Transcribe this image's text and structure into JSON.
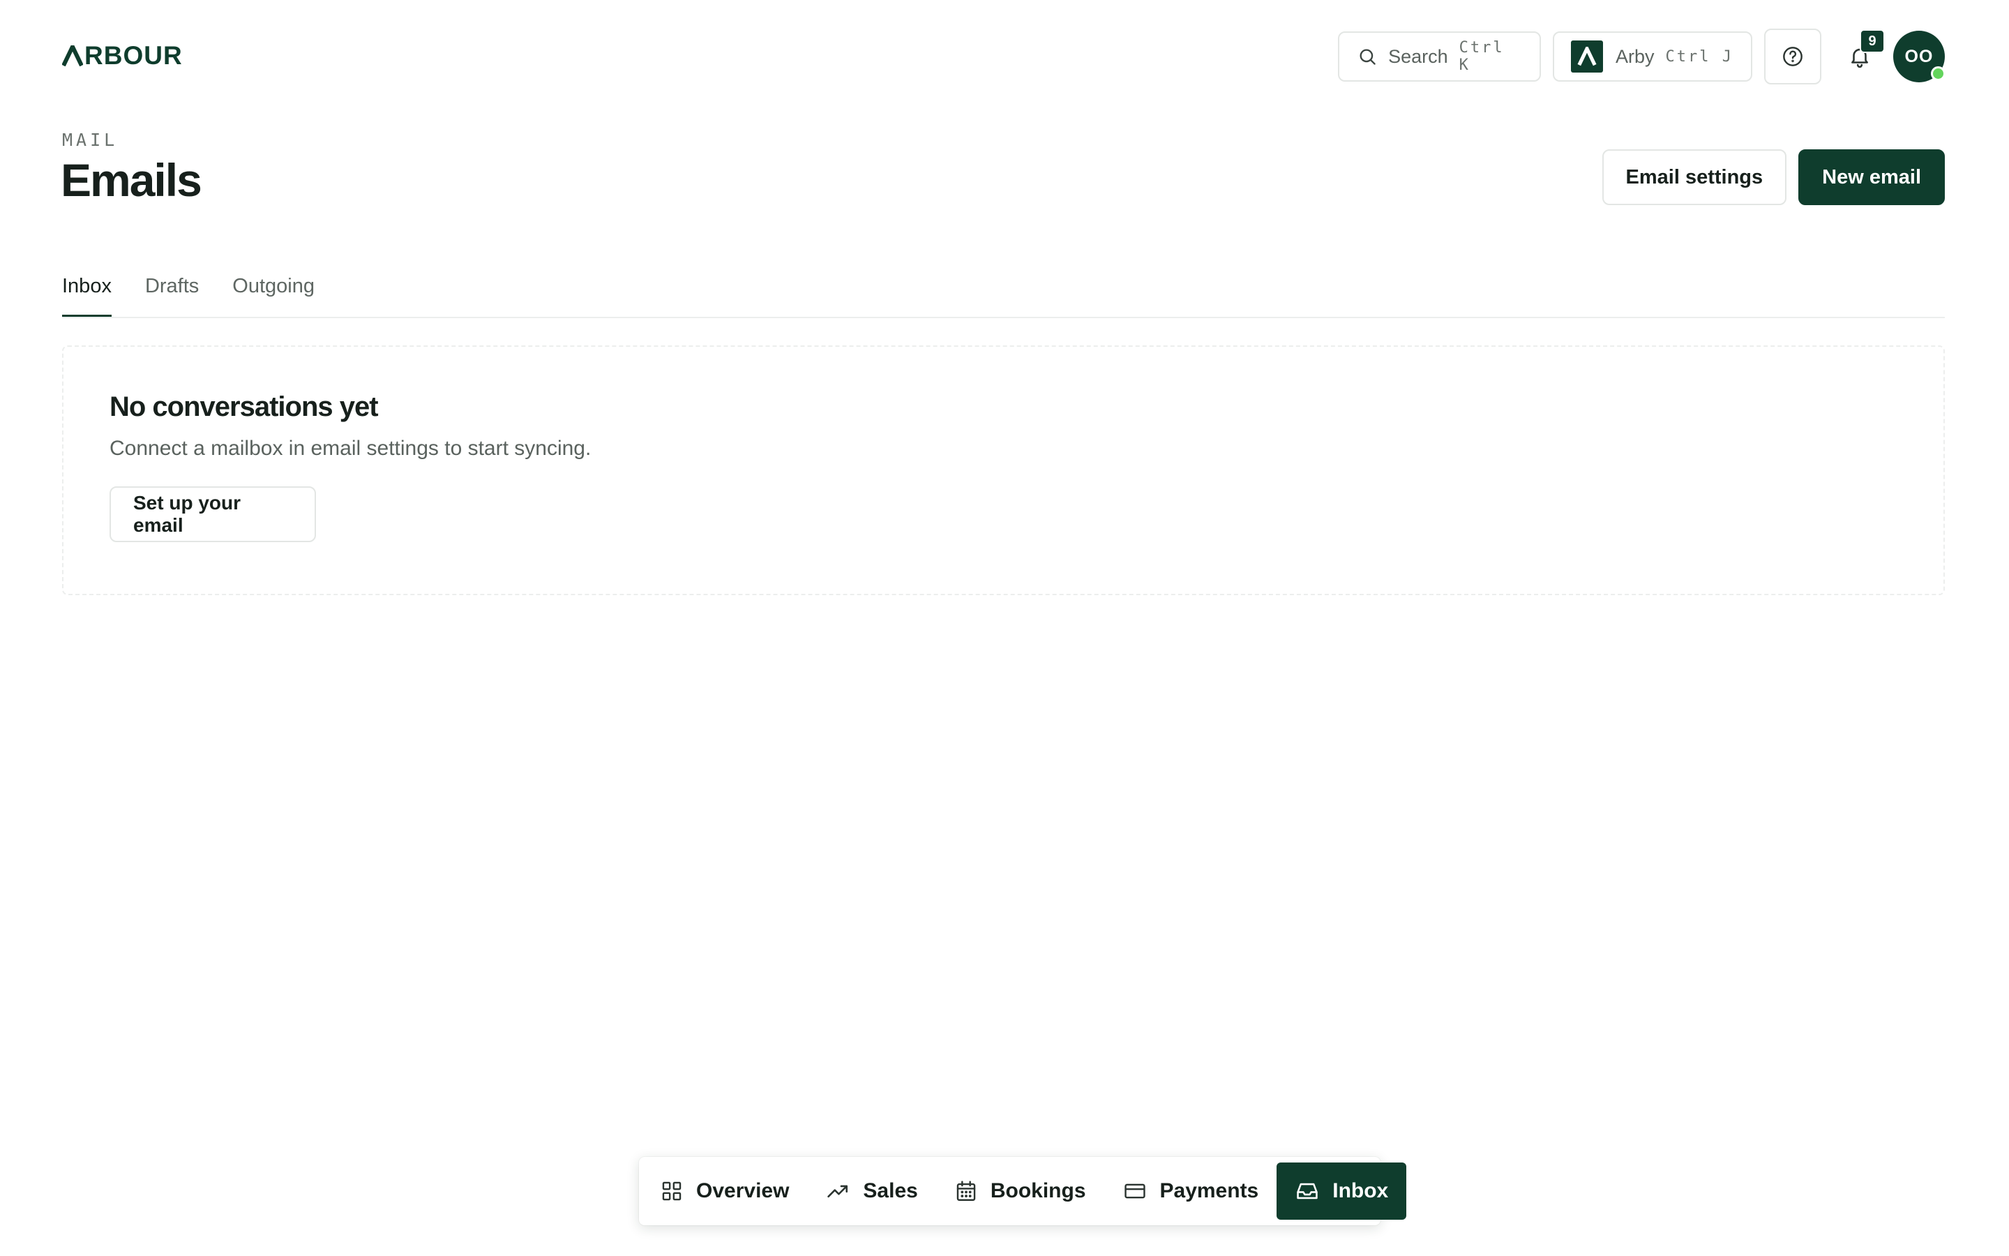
{
  "header": {
    "logo_text": "RBOUR",
    "search": {
      "label": "Search",
      "shortcut": "Ctrl K"
    },
    "assistant": {
      "label": "Arby",
      "shortcut": "Ctrl J"
    },
    "notifications_count": "9",
    "avatar_initials": "OO"
  },
  "page": {
    "eyebrow": "MAIL",
    "title": "Emails",
    "actions": {
      "settings_label": "Email settings",
      "new_label": "New email"
    }
  },
  "tabs": [
    {
      "label": "Inbox",
      "active": true
    },
    {
      "label": "Drafts",
      "active": false
    },
    {
      "label": "Outgoing",
      "active": false
    }
  ],
  "empty_state": {
    "title": "No conversations yet",
    "description": "Connect a mailbox in email settings to start syncing.",
    "cta_label": "Set up your email"
  },
  "dock": {
    "items": [
      {
        "label": "Overview",
        "icon": "grid-icon",
        "active": false
      },
      {
        "label": "Sales",
        "icon": "trending-up-icon",
        "active": false
      },
      {
        "label": "Bookings",
        "icon": "calendar-icon",
        "active": false
      },
      {
        "label": "Payments",
        "icon": "credit-card-icon",
        "active": false
      },
      {
        "label": "Inbox",
        "icon": "inbox-icon",
        "active": true
      }
    ]
  },
  "colors": {
    "brand": "#0f3d2d",
    "presence": "#63d45c",
    "border": "#e3e6e4"
  }
}
